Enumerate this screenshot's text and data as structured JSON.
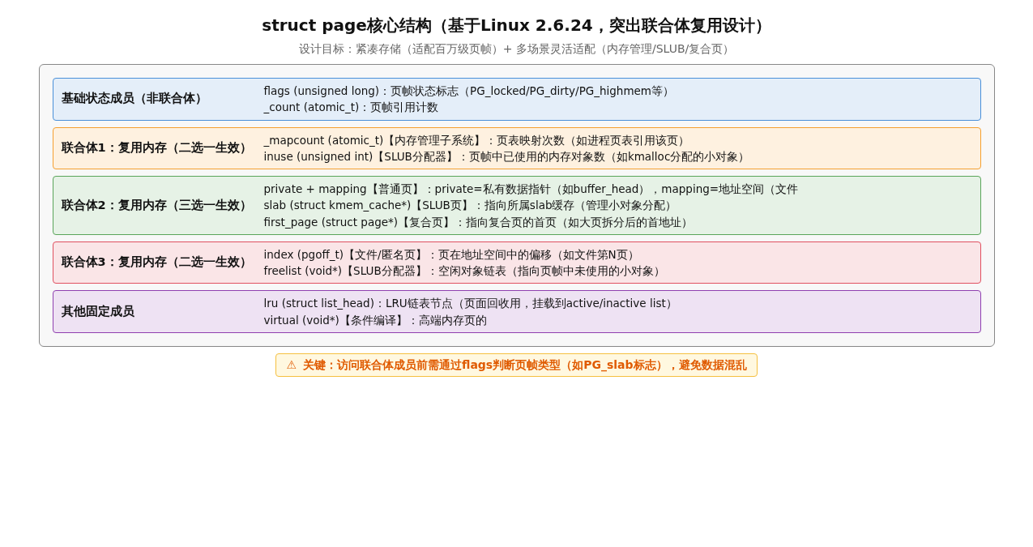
{
  "title": "struct page核心结构（基于Linux 2.6.24，突出联合体复用设计）",
  "subtitle": "设计目标：紧凑存储（适配百万级页帧）+ 多场景灵活适配（内存管理/SLUB/复合页）",
  "sections": [
    {
      "title": "基础状态成员（非联合体）",
      "color": "#4a90d9",
      "members": [
        "flags (unsigned long)：页帧状态标志（PG_locked/PG_dirty/PG_highmem等）",
        "_count (atomic_t)：页帧引用计数"
      ]
    },
    {
      "title": "联合体1：复用内存（二选一生效）",
      "color": "#f5a030",
      "members": [
        "_mapcount (atomic_t)【内存管理子系统】：页表映射次数（如进程页表引用该页）",
        "inuse (unsigned int)【SLUB分配器】：页帧中已使用的内存对象数（如kmalloc分配的小对象）"
      ]
    },
    {
      "title": "联合体2：复用内存（三选一生效）",
      "color": "#5aa55a",
      "members": [
        "private + mapping【普通页】：private=私有数据指针（如buffer_head），mapping=地址空间（文件",
        "slab (struct kmem_cache*)【SLUB页】：指向所属slab缓存（管理小对象分配）",
        "first_page (struct page*)【复合页】：指向复合页的首页（如大页拆分后的首地址）"
      ]
    },
    {
      "title": "联合体3：复用内存（二选一生效）",
      "color": "#e05060",
      "members": [
        "index (pgoff_t)【文件/匿名页】：页在地址空间中的偏移（如文件第N页）",
        "freelist (void*)【SLUB分配器】：空闲对象链表（指向页帧中未使用的小对象）"
      ]
    },
    {
      "title": "其他固定成员",
      "color": "#9040b0",
      "members": [
        "lru (struct list_head)：LRU链表节点（页面回收用，挂载到active/inactive list）",
        "virtual (void*)【条件编译】：高端内存页的"
      ]
    }
  ],
  "warning": {
    "icon": "⚠",
    "text": "关键：访问联合体成员前需通过flags判断页帧类型（如PG_slab标志），避免数据混乱"
  }
}
